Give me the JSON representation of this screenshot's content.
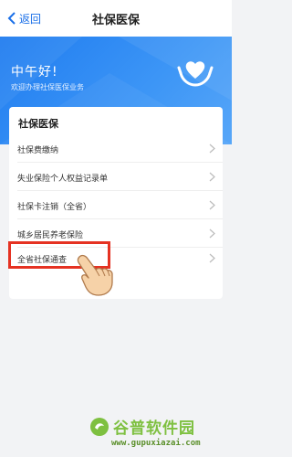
{
  "nav": {
    "back_label": "返回",
    "title": "社保医保"
  },
  "banner": {
    "greeting": "中午好!",
    "subtitle": "欢迎办理社保医保业务"
  },
  "card": {
    "title": "社保医保",
    "items": [
      {
        "label": "社保费缴纳"
      },
      {
        "label": "失业保险个人权益记录单"
      },
      {
        "label": "社保卡注销（全省）"
      },
      {
        "label": "城乡居民养老保险"
      },
      {
        "label": "全省社保通查"
      }
    ]
  },
  "watermark": {
    "title": "谷普软件园",
    "url": "www.gupuxiazai.com"
  },
  "colors": {
    "accent": "#1a6fe8",
    "banner": "#2f8af3",
    "highlight": "#e53222"
  }
}
